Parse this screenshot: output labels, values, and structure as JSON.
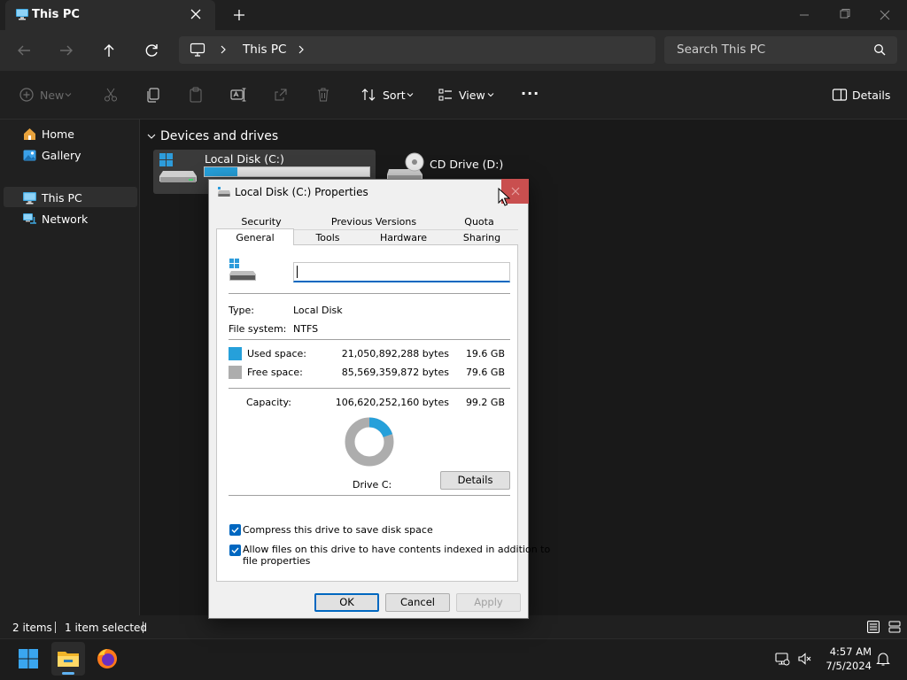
{
  "window": {
    "tab_title": "This PC",
    "close_tab": "×",
    "new_tab": "+"
  },
  "address_bar": {
    "crumb": "This PC",
    "search_placeholder": "Search This PC"
  },
  "toolbar": {
    "new_label": "New",
    "sort_label": "Sort",
    "view_label": "View",
    "more_label": "···",
    "details_label": "Details"
  },
  "sidebar": {
    "items": [
      {
        "label": "Home"
      },
      {
        "label": "Gallery"
      },
      {
        "label": "This PC"
      },
      {
        "label": "Network"
      }
    ]
  },
  "content": {
    "section_title": "Devices and drives",
    "drives": [
      {
        "name": "Local Disk (C:)",
        "used_fraction": 0.2
      },
      {
        "name": "CD Drive (D:)"
      }
    ]
  },
  "status": {
    "item_count": "2 items",
    "selected": "1 item selected"
  },
  "taskbar": {
    "time": "4:57 AM",
    "date": "7/5/2024"
  },
  "dialog": {
    "title": "Local Disk (C:) Properties",
    "tabs_top": [
      "Security",
      "Previous Versions",
      "Quota"
    ],
    "tabs_bottom": [
      "General",
      "Tools",
      "Hardware",
      "Sharing"
    ],
    "active_tab": "General",
    "name_value": "",
    "type_label": "Type:",
    "type_value": "Local Disk",
    "fs_label": "File system:",
    "fs_value": "NTFS",
    "used_label": "Used space:",
    "used_bytes": "21,050,892,288 bytes",
    "used_gb": "19.6 GB",
    "free_label": "Free space:",
    "free_bytes": "85,569,359,872 bytes",
    "free_gb": "79.6 GB",
    "capacity_label": "Capacity:",
    "capacity_bytes": "106,620,252,160 bytes",
    "capacity_gb": "99.2 GB",
    "drive_label": "Drive C:",
    "details_button": "Details",
    "compress_label": "Compress this drive to save disk space",
    "index_label_1": "Allow files on this drive to have contents indexed in addition to",
    "index_label_2": "file properties",
    "compress_checked": true,
    "index_checked": true,
    "ok": "OK",
    "cancel": "Cancel",
    "apply": "Apply",
    "used_fraction": 0.1974,
    "colors": {
      "used": "#26a0da",
      "free": "#adadad"
    }
  }
}
